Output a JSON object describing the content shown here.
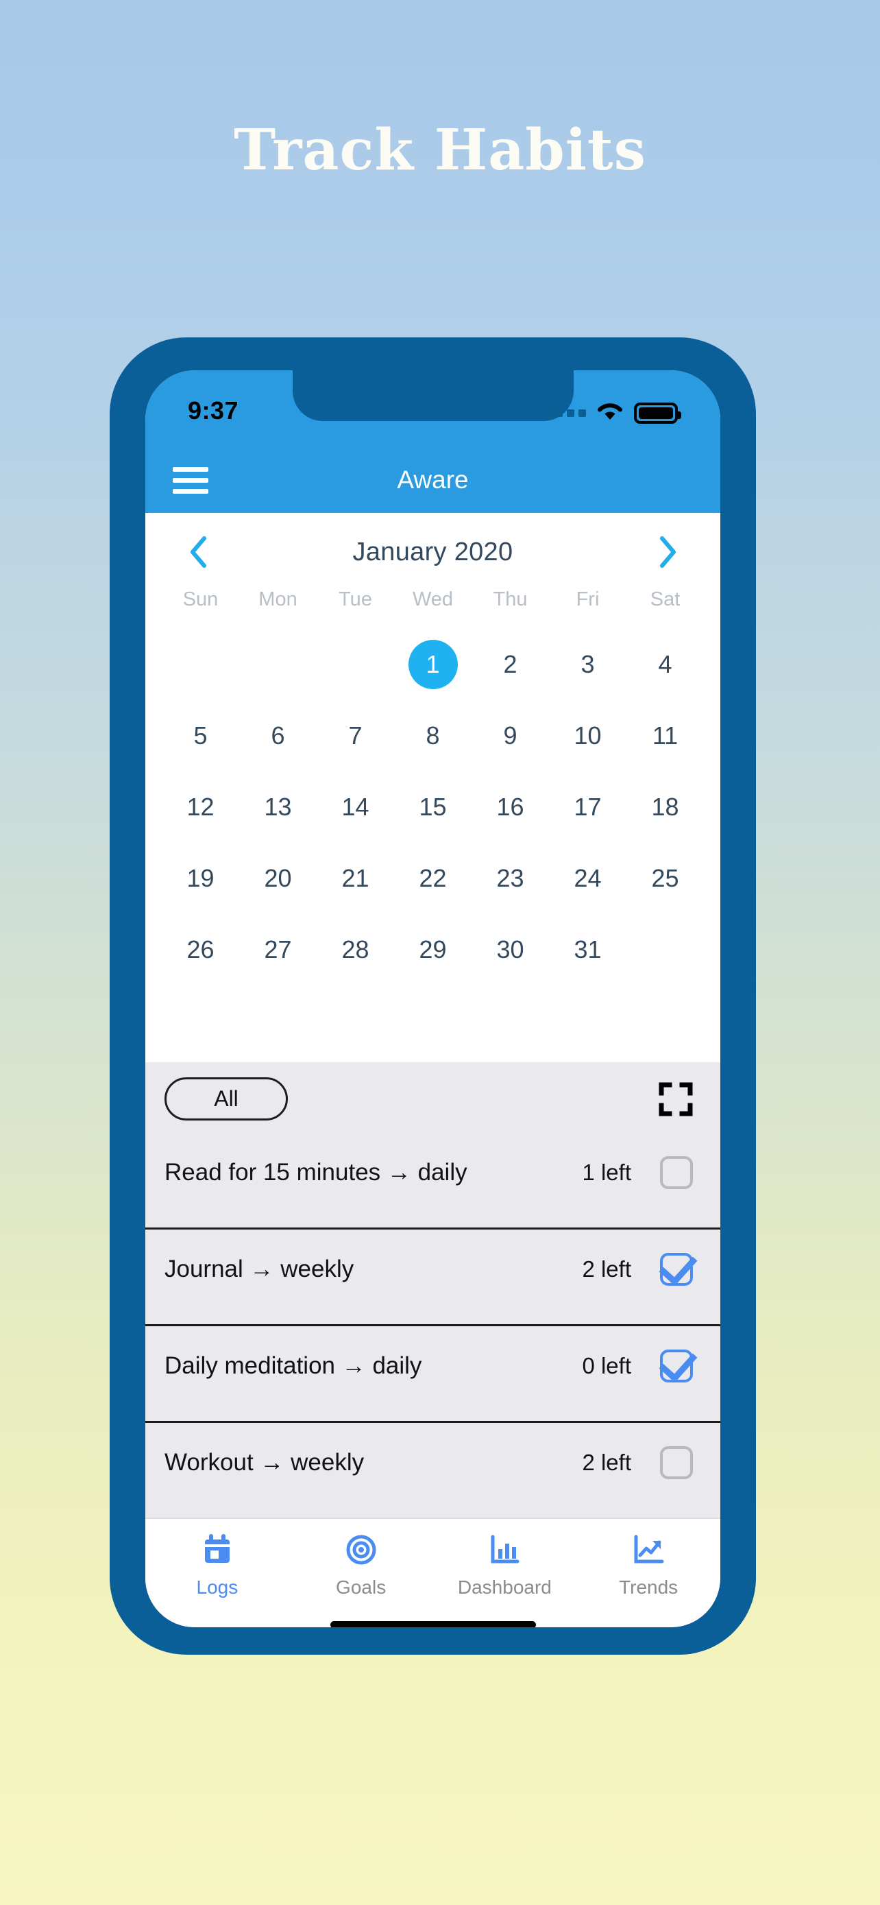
{
  "headline": "Track Habits",
  "colors": {
    "brand_blue": "#2a9ae1",
    "frame_blue": "#0b5f99",
    "accent_blue": "#20b2f0",
    "check_blue": "#4a8cf0",
    "list_bg": "#e9e9ee"
  },
  "status_bar": {
    "time": "9:37",
    "signal_icon": "signal-dots-icon",
    "wifi_icon": "wifi-icon",
    "battery_icon": "battery-full-icon"
  },
  "app_bar": {
    "menu_icon": "hamburger-menu-icon",
    "title": "Aware"
  },
  "calendar": {
    "prev_icon": "chevron-left-icon",
    "next_icon": "chevron-right-icon",
    "month_label": "January 2020",
    "weekdays": [
      "Sun",
      "Mon",
      "Tue",
      "Wed",
      "Thu",
      "Fri",
      "Sat"
    ],
    "leading_blanks": 3,
    "days": [
      1,
      2,
      3,
      4,
      5,
      6,
      7,
      8,
      9,
      10,
      11,
      12,
      13,
      14,
      15,
      16,
      17,
      18,
      19,
      20,
      21,
      22,
      23,
      24,
      25,
      26,
      27,
      28,
      29,
      30,
      31
    ],
    "selected_day": 1
  },
  "filter_bar": {
    "chip_label": "All",
    "expand_icon": "fullscreen-expand-icon"
  },
  "habits": [
    {
      "name": "Read for 15 minutes → daily",
      "left": "1 left",
      "checked": false
    },
    {
      "name": "Journal → weekly",
      "left": "2 left",
      "checked": true
    },
    {
      "name": "Daily meditation → daily",
      "left": "0 left",
      "checked": true
    },
    {
      "name": "Workout → weekly",
      "left": "2 left",
      "checked": false
    }
  ],
  "tabs": [
    {
      "label": "Logs",
      "icon": "calendar-icon",
      "active": true
    },
    {
      "label": "Goals",
      "icon": "target-icon",
      "active": false
    },
    {
      "label": "Dashboard",
      "icon": "bar-chart-icon",
      "active": false
    },
    {
      "label": "Trends",
      "icon": "line-chart-icon",
      "active": false
    }
  ],
  "home_indicator": "home-indicator-bar"
}
